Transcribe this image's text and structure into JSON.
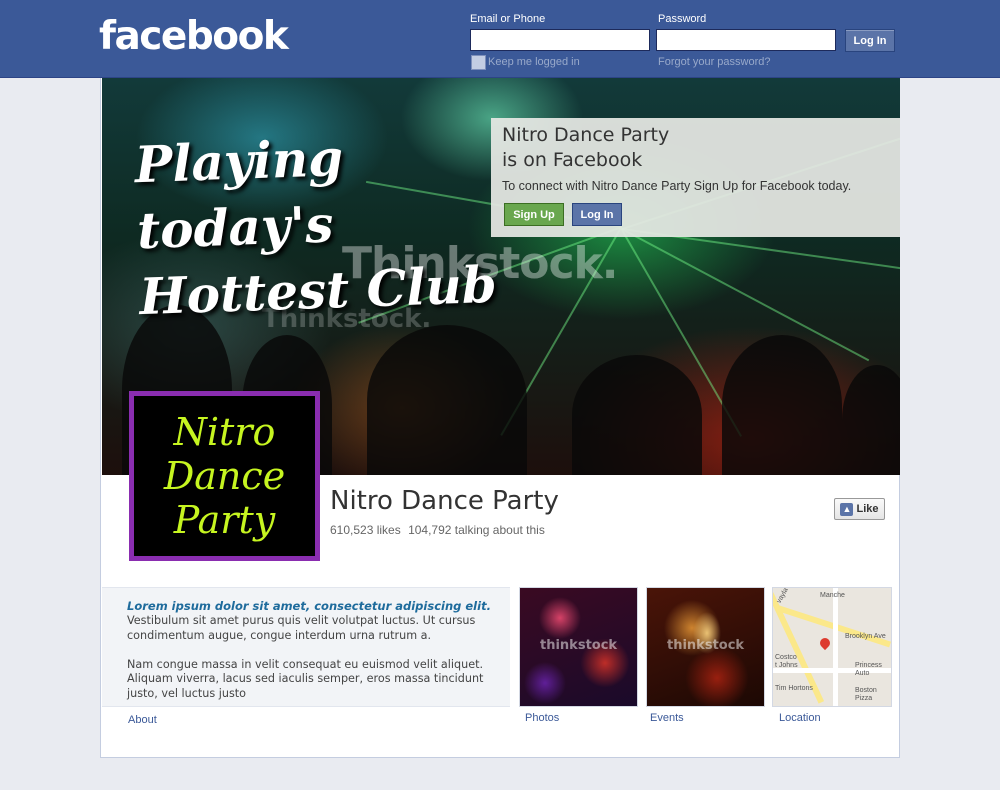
{
  "header": {
    "logo": "facebook",
    "email_label": "Email or Phone",
    "password_label": "Password",
    "login_label": "Log In",
    "keep_label": "Keep me logged in",
    "forgot_label": "Forgot your password?"
  },
  "cover": {
    "slogan": [
      "Playing",
      "today's",
      "Hottest Club"
    ],
    "watermark": "Thinkstock."
  },
  "promo": {
    "title_line1": "Nitro Dance Party",
    "title_line2": "is on Facebook",
    "text": "To connect with Nitro Dance Party Sign Up for Facebook today.",
    "signup_label": "Sign Up",
    "login_label": "Log In"
  },
  "profile": {
    "pic_lines": [
      "Nitro",
      "Dance",
      "Party"
    ],
    "name": "Nitro Dance Party",
    "likes": "610,523 likes",
    "talking": "104,792 talking about this",
    "like_label": "Like"
  },
  "about": {
    "heading": "Lorem ipsum dolor sit amet, consectetur adipiscing elit.",
    "para1": "Vestibulum sit amet purus quis velit volutpat luctus. Ut cursus condimentum augue, congue interdum urna rutrum a.",
    "para2": "Nam congue massa in velit consequat eu euismod velit aliquet. Aliquam viverra, lacus sed iaculis semper, eros massa tincidunt justo, vel luctus justo",
    "link": "About"
  },
  "tiles": {
    "photos": "Photos",
    "events": "Events",
    "location": "Location",
    "tile_watermark": "thinkstock",
    "map_labels": {
      "manchester": "Manche",
      "brooklyn": "Brooklyn Ave",
      "costco": "Costco",
      "st_johns": "t Johns",
      "princess": "Princess",
      "auto": "Auto",
      "tim": "Tim Hortons",
      "boston": "Boston",
      "pizza": "Pizza",
      "vayla": "vayla"
    }
  },
  "colors": {
    "brand": "#3b5998",
    "signup": "#69a74e",
    "profile_border": "#8a2db0",
    "profile_text": "#c6f520"
  }
}
